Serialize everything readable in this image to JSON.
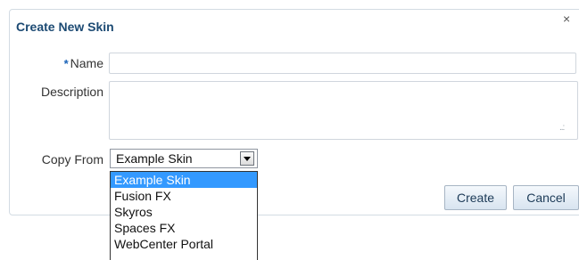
{
  "dialog": {
    "title": "Create New Skin",
    "close_glyph": "×"
  },
  "form": {
    "name": {
      "required_marker": "*",
      "label": "Name",
      "value": ""
    },
    "description": {
      "label": "Description",
      "value": "",
      "resize_grip": "..:"
    },
    "copy_from": {
      "label": "Copy From",
      "selected": "Example Skin",
      "options": [
        "Example Skin",
        "Fusion FX",
        "Skyros",
        "Spaces FX",
        "WebCenter Portal"
      ]
    }
  },
  "buttons": {
    "create": "Create",
    "cancel": "Cancel"
  },
  "colors": {
    "title": "#1c4a73",
    "required": "#1a63b8",
    "highlight": "#3399ff"
  }
}
